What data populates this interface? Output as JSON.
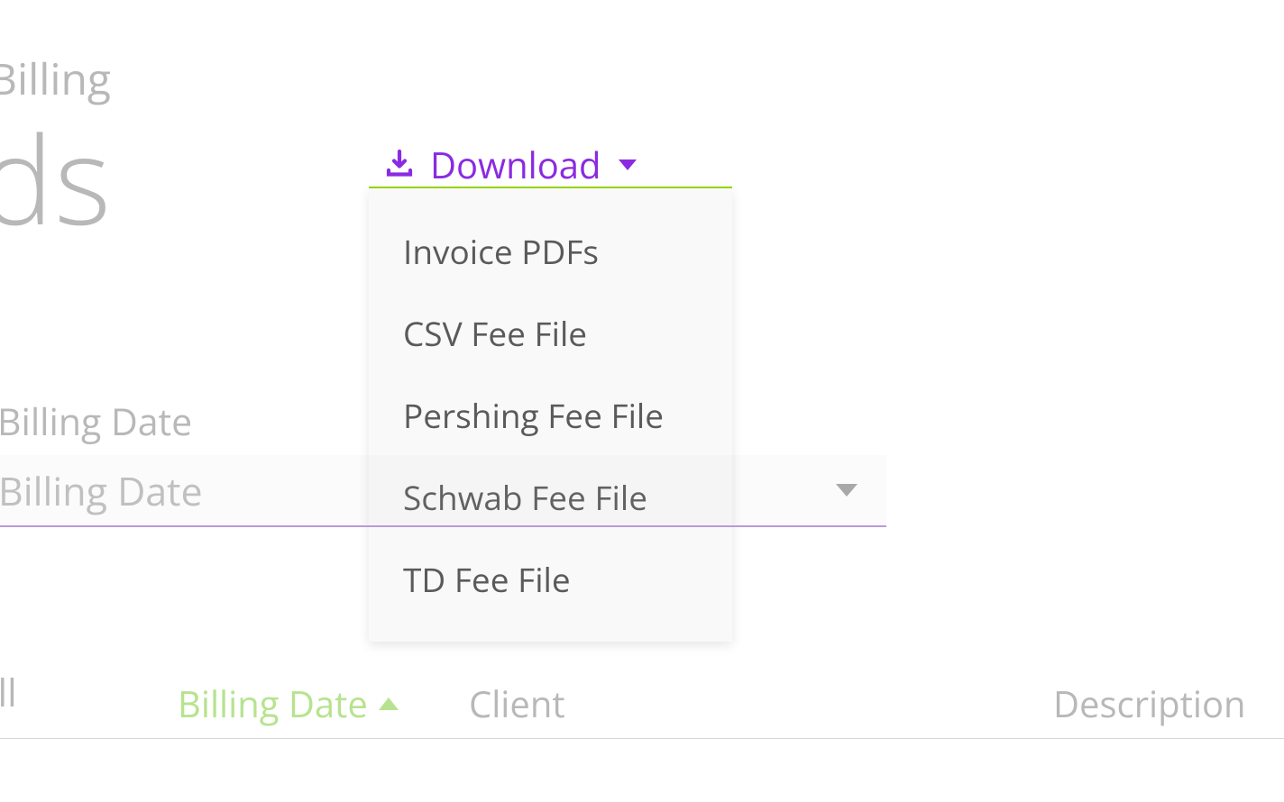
{
  "breadcrumb": "Billing",
  "page_title": "cords",
  "download": {
    "label": "Download",
    "menu_items": [
      "Invoice PDFs",
      "CSV Fee File",
      "Pershing Fee File",
      "Schwab Fee File",
      "TD Fee File"
    ]
  },
  "filter": {
    "label": "Billing Date",
    "placeholder": "Billing Date"
  },
  "table": {
    "select_all_label": "ct All",
    "columns": {
      "billing_date": "Billing Date",
      "client": "Client",
      "description": "Description"
    }
  },
  "colors": {
    "accent_purple": "#8a2be2",
    "accent_green": "#97d700",
    "text_gray": "#b8b8b8"
  }
}
